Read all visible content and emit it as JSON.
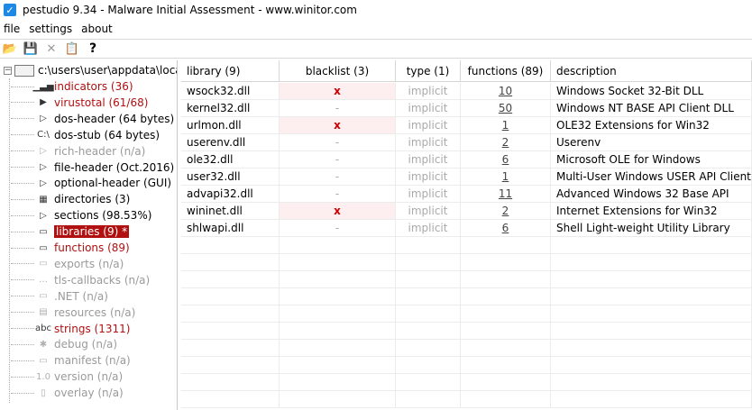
{
  "window": {
    "title": "pestudio 9.34 - Malware Initial Assessment - www.winitor.com"
  },
  "menu": [
    "file",
    "settings",
    "about"
  ],
  "toolbar": {
    "buttons": [
      {
        "name": "open-folder-icon",
        "glyph": "📂"
      },
      {
        "name": "save-icon",
        "glyph": "💾"
      },
      {
        "name": "close-icon",
        "glyph": "✕"
      },
      {
        "name": "clipboard-icon",
        "glyph": "📋"
      },
      {
        "name": "help-icon",
        "glyph": "?"
      }
    ]
  },
  "tree": {
    "root": "c:\\users\\user\\appdata\\local\\",
    "items": [
      {
        "label": "indicators (36)",
        "style": "red",
        "icon": "bar-chart-icon",
        "glyph": "▁▃▅"
      },
      {
        "label": "virustotal (61/68)",
        "style": "red",
        "icon": "virustotal-icon",
        "glyph": "▶"
      },
      {
        "label": "dos-header (64 bytes)",
        "style": "black",
        "icon": "expand-arrow-icon",
        "glyph": "▷"
      },
      {
        "label": "dos-stub (64 bytes)",
        "style": "black",
        "icon": "dos-console-icon",
        "glyph": "C:\\"
      },
      {
        "label": "rich-header (n/a)",
        "style": "gray",
        "icon": "expand-arrow-icon",
        "glyph": "▷"
      },
      {
        "label": "file-header (Oct.2016)",
        "style": "black",
        "icon": "expand-arrow-icon",
        "glyph": "▷"
      },
      {
        "label": "optional-header (GUI)",
        "style": "black",
        "icon": "expand-arrow-icon",
        "glyph": "▷"
      },
      {
        "label": "directories (3)",
        "style": "black",
        "icon": "directories-icon",
        "glyph": "▦"
      },
      {
        "label": "sections (98.53%)",
        "style": "black",
        "icon": "expand-arrow-icon",
        "glyph": "▷"
      },
      {
        "label": "libraries (9) *",
        "style": "selected",
        "icon": "library-icon",
        "glyph": "▭"
      },
      {
        "label": "functions (89)",
        "style": "red",
        "icon": "functions-icon",
        "glyph": "▭"
      },
      {
        "label": "exports (n/a)",
        "style": "gray",
        "icon": "exports-icon",
        "glyph": "▭"
      },
      {
        "label": "tls-callbacks (n/a)",
        "style": "gray",
        "icon": "tls-icon",
        "glyph": "…"
      },
      {
        "label": ".NET (n/a)",
        "style": "gray",
        "icon": "dotnet-icon",
        "glyph": "▭"
      },
      {
        "label": "resources (n/a)",
        "style": "gray",
        "icon": "resources-icon",
        "glyph": "▤"
      },
      {
        "label": "strings (1311)",
        "style": "red",
        "icon": "strings-icon",
        "glyph": "abc"
      },
      {
        "label": "debug (n/a)",
        "style": "gray",
        "icon": "bug-icon",
        "glyph": "✱"
      },
      {
        "label": "manifest (n/a)",
        "style": "gray",
        "icon": "manifest-icon",
        "glyph": "▭"
      },
      {
        "label": "version (n/a)",
        "style": "gray",
        "icon": "version-icon",
        "glyph": "1.0"
      },
      {
        "label": "overlay (n/a)",
        "style": "gray",
        "icon": "overlay-icon",
        "glyph": "▯"
      }
    ]
  },
  "table": {
    "headers": [
      "library (9)",
      "blacklist (3)",
      "type (1)",
      "functions (89)",
      "description"
    ],
    "rows": [
      {
        "library": "wsock32.dll",
        "blacklist": "x",
        "type": "implicit",
        "functions": "10",
        "description": "Windows Socket 32-Bit DLL"
      },
      {
        "library": "kernel32.dll",
        "blacklist": "-",
        "type": "implicit",
        "functions": "50",
        "description": "Windows NT BASE API Client DLL"
      },
      {
        "library": "urlmon.dll",
        "blacklist": "x",
        "type": "implicit",
        "functions": "1",
        "description": "OLE32 Extensions for Win32"
      },
      {
        "library": "userenv.dll",
        "blacklist": "-",
        "type": "implicit",
        "functions": "2",
        "description": "Userenv"
      },
      {
        "library": "ole32.dll",
        "blacklist": "-",
        "type": "implicit",
        "functions": "6",
        "description": "Microsoft OLE for Windows"
      },
      {
        "library": "user32.dll",
        "blacklist": "-",
        "type": "implicit",
        "functions": "1",
        "description": "Multi-User Windows USER API Client DLL"
      },
      {
        "library": "advapi32.dll",
        "blacklist": "-",
        "type": "implicit",
        "functions": "11",
        "description": "Advanced Windows 32 Base API"
      },
      {
        "library": "wininet.dll",
        "blacklist": "x",
        "type": "implicit",
        "functions": "2",
        "description": "Internet Extensions for Win32"
      },
      {
        "library": "shlwapi.dll",
        "blacklist": "-",
        "type": "implicit",
        "functions": "6",
        "description": "Shell Light-weight Utility Library"
      }
    ],
    "empty_rows": 10
  },
  "colors": {
    "accent_red": "#b01010",
    "blacklist_bg": "#fdeef0",
    "disabled_gray": "#9a9a9a"
  }
}
